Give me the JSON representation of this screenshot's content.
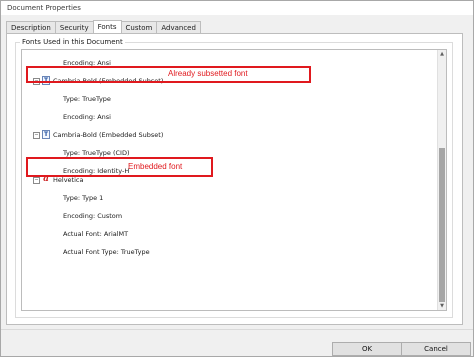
{
  "window": {
    "title": "Document Properties"
  },
  "tabs": [
    "Description",
    "Security",
    "Fonts",
    "Custom",
    "Advanced"
  ],
  "active_tab": "Fonts",
  "fonts_group": {
    "title": "Fonts Used in this Document"
  },
  "font_list": {
    "rows": [
      "Encoding: Ansi",
      "Cambria-Bold (Embedded Subset)",
      "Type: TrueType",
      "Encoding: Ansi",
      "Cambria-Bold (Embedded Subset)",
      "Type: TrueType (CID)",
      "Encoding: Identity-H",
      "Helvetica",
      "Type: Type 1",
      "Encoding: Custom",
      "Actual Font: ArialMT",
      "Actual Font Type: TrueType"
    ],
    "font_icon_glyph": "T",
    "type1_icon_glyph": "a",
    "expanded_glyph": "−"
  },
  "annotations": {
    "subset": "Already subsetted font",
    "embedded": "Embedded font",
    "color": "#e0191e"
  },
  "scrollbar": {
    "up_glyph": "▲",
    "down_glyph": "▼"
  },
  "buttons": {
    "ok": "OK",
    "cancel": "Cancel"
  }
}
